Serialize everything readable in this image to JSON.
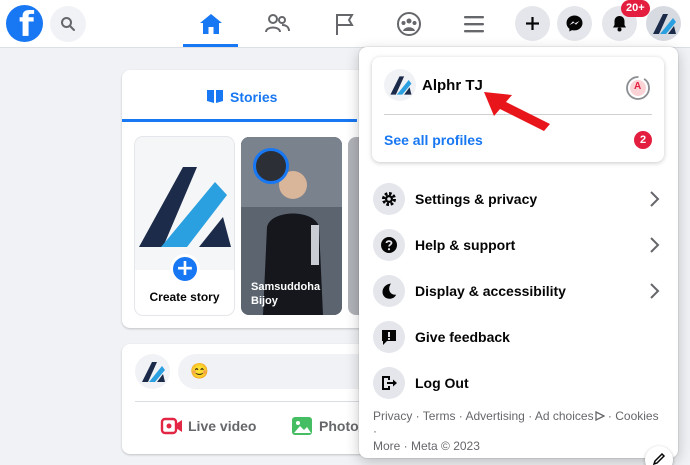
{
  "topbar": {
    "logo_letter": "f",
    "notification_badge": "20+"
  },
  "nav": {
    "active": "home",
    "icons": [
      "home-icon",
      "friends-icon",
      "pages-flag-icon",
      "groups-icon",
      "menu-icon"
    ]
  },
  "stories": {
    "tab_label": "Stories",
    "create_label": "Create story",
    "plus": "+",
    "story_name": "Samsuddoha Bijoy"
  },
  "composer": {
    "live_video_label": "Live video",
    "photo_video_label": "Photo/",
    "emoji": "😊"
  },
  "profile": {
    "name": "Alphr TJ",
    "see_all_label": "See all profiles",
    "see_all_count": "2",
    "switch_initial": "A"
  },
  "menu": {
    "items": [
      {
        "label": "Settings & privacy",
        "icon": "gear-icon",
        "has_chevron": true
      },
      {
        "label": "Help & support",
        "icon": "question-icon",
        "has_chevron": true
      },
      {
        "label": "Display & accessibility",
        "icon": "moon-icon",
        "has_chevron": true
      },
      {
        "label": "Give feedback",
        "icon": "feedback-icon",
        "has_chevron": false
      },
      {
        "label": "Log Out",
        "icon": "logout-icon",
        "has_chevron": false
      }
    ]
  },
  "footer": {
    "privacy": "Privacy",
    "terms": "Terms",
    "advertising": "Advertising",
    "ad_choices": "Ad choices",
    "cookies": "Cookies",
    "more": "More",
    "copyright": "Meta © 2023",
    "separator": " · "
  },
  "colors": {
    "brand": "#1877f2",
    "alert": "#e41e3f",
    "arrow": "#e8151b",
    "background": "#f0f2f5"
  }
}
